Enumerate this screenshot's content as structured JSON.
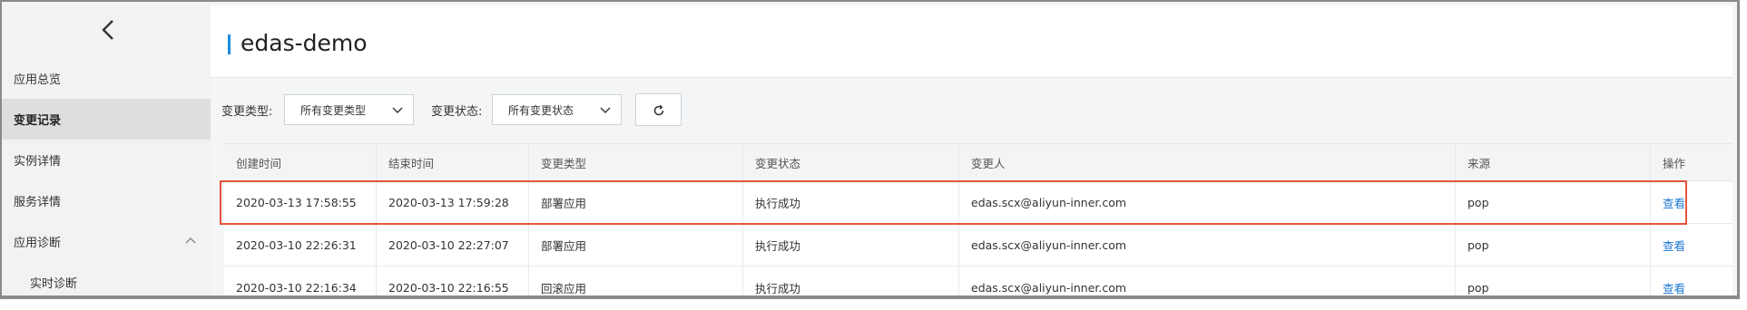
{
  "sidebar": {
    "items": [
      {
        "label": "应用总览"
      },
      {
        "label": "变更记录"
      },
      {
        "label": "实例详情"
      },
      {
        "label": "服务详情"
      },
      {
        "label": "应用诊断"
      },
      {
        "label": "实时诊断"
      }
    ]
  },
  "header": {
    "title": "edas-demo"
  },
  "filters": {
    "type_label": "变更类型:",
    "type_value": "所有变更类型",
    "status_label": "变更状态:",
    "status_value": "所有变更状态"
  },
  "table": {
    "columns": [
      "创建时间",
      "结束时间",
      "变更类型",
      "变更状态",
      "变更人",
      "来源",
      "操作"
    ],
    "rows": [
      {
        "created": "2020-03-13 17:58:55",
        "ended": "2020-03-13 17:59:28",
        "type": "部署应用",
        "status": "执行成功",
        "user": "edas.scx@aliyun-inner.com",
        "source": "pop",
        "action": "查看"
      },
      {
        "created": "2020-03-10 22:26:31",
        "ended": "2020-03-10 22:27:07",
        "type": "部署应用",
        "status": "执行成功",
        "user": "edas.scx@aliyun-inner.com",
        "source": "pop",
        "action": "查看"
      },
      {
        "created": "2020-03-10 22:16:34",
        "ended": "2020-03-10 22:16:55",
        "type": "回滚应用",
        "status": "执行成功",
        "user": "edas.scx@aliyun-inner.com",
        "source": "pop",
        "action": "查看"
      }
    ]
  },
  "colors": {
    "accent": "#1c8de0",
    "link": "#1c76d2",
    "highlight": "#e5533d",
    "top_accent": "#e8772e"
  }
}
